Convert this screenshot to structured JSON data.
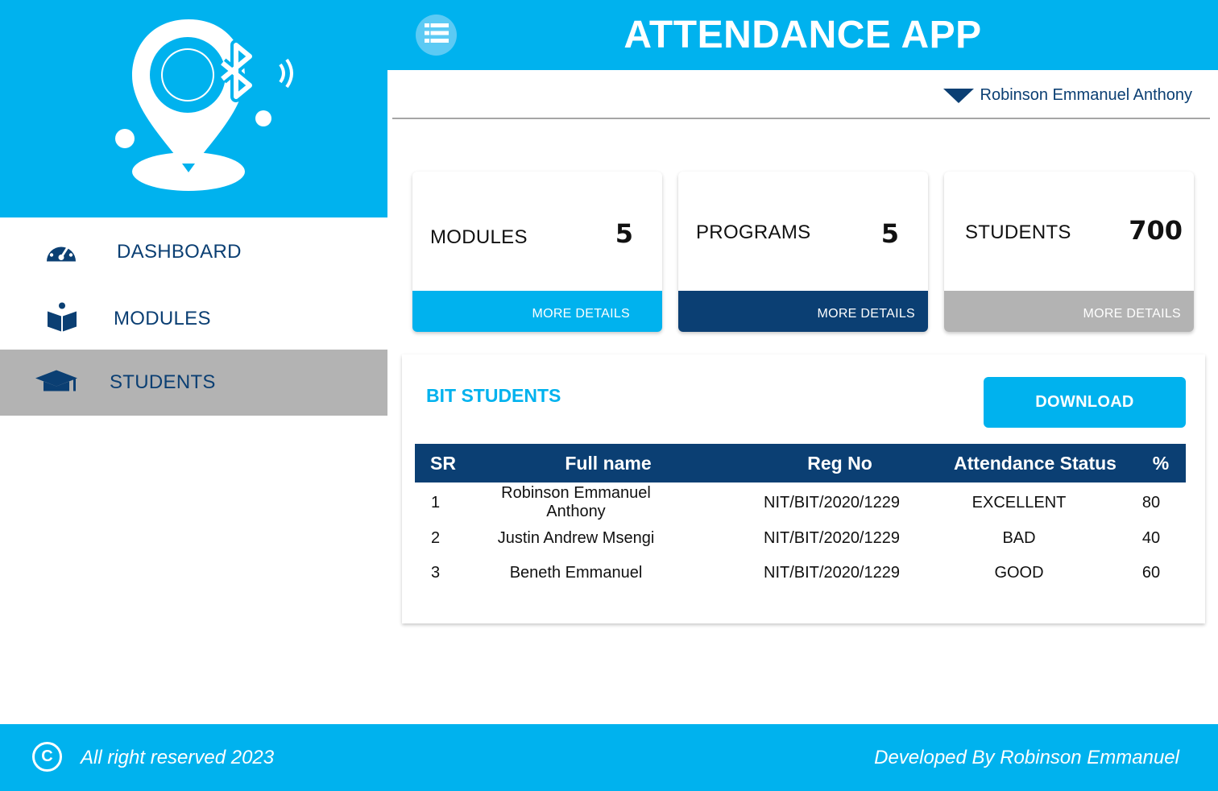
{
  "brand": {
    "logo_icon": "location-pin-bluetooth-icon"
  },
  "header": {
    "title": "ATTENDANCE APP",
    "menu_icon": "list-icon"
  },
  "user": {
    "name": "Robinson Emmanuel Anthony"
  },
  "sidebar": {
    "items": [
      {
        "label": "DASHBOARD",
        "icon": "speedometer-icon"
      },
      {
        "label": "MODULES",
        "icon": "book-reader-icon"
      },
      {
        "label": "STUDENTS",
        "icon": "graduation-cap-icon",
        "active": true
      }
    ]
  },
  "stats": [
    {
      "label": "MODULES",
      "value": "5",
      "action": "MORE DETAILS",
      "color": "#00b2ee"
    },
    {
      "label": "PROGRAMS",
      "value": "5",
      "action": "MORE DETAILS",
      "color": "#0b3f73"
    },
    {
      "label": "STUDENTS",
      "value": "700",
      "action": "MORE DETAILS",
      "color": "#b3b3b3"
    }
  ],
  "students_panel": {
    "title": "BIT STUDENTS",
    "download_label": "DOWNLOAD",
    "columns": [
      "SR",
      "Full name",
      "Reg No",
      "Attendance Status",
      "%"
    ],
    "rows": [
      {
        "sr": "1",
        "name": "Robinson Emmanuel Anthony",
        "reg": "NIT/BIT/2020/1229",
        "status": "EXCELLENT",
        "pct": "80"
      },
      {
        "sr": "2",
        "name": "Justin Andrew Msengi",
        "reg": "NIT/BIT/2020/1229",
        "status": "BAD",
        "pct": "40"
      },
      {
        "sr": "3",
        "name": "Beneth Emmanuel",
        "reg": "NIT/BIT/2020/1229",
        "status": "GOOD",
        "pct": "60"
      }
    ]
  },
  "footer": {
    "copyright_icon": "copyright-icon",
    "copyright_symbol": "C",
    "copyright": "All right reserved 2023",
    "developer": "Developed By Robinson Emmanuel"
  },
  "colors": {
    "primary": "#00b2ee",
    "navy": "#0b3f73",
    "gray": "#b3b3b3"
  }
}
